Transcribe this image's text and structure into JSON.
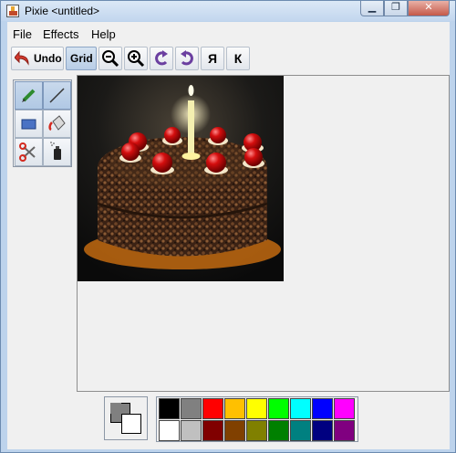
{
  "window": {
    "title": "Pixie <untitled>",
    "min_glyph": "▁",
    "max_glyph": "❐",
    "close_glyph": "✕"
  },
  "menu": [
    {
      "label": "File"
    },
    {
      "label": "Effects"
    },
    {
      "label": "Help"
    }
  ],
  "toolbar": {
    "undo_label": "Undo",
    "grid_label": "Grid",
    "mirror_glyph": "Я",
    "flip_glyph": "К"
  },
  "tools": [
    "pencil-tool",
    "line-tool",
    "rectangle-tool",
    "fill-bucket-tool",
    "scissors-tool",
    "spray-can-tool"
  ],
  "palette": {
    "top_row": [
      "#000000",
      "#808080",
      "#ff0000",
      "#ffc000",
      "#ffff00",
      "#00ff00",
      "#00ffff",
      "#0000ff",
      "#ff00ff"
    ],
    "bottom_row": [
      "#ffffff",
      "#c0c0c0",
      "#800000",
      "#804000",
      "#808000",
      "#008000",
      "#008080",
      "#000080",
      "#800080"
    ],
    "foreground": "#808080",
    "background": "#ffffff"
  },
  "image": {
    "subject": "cake-picture"
  }
}
